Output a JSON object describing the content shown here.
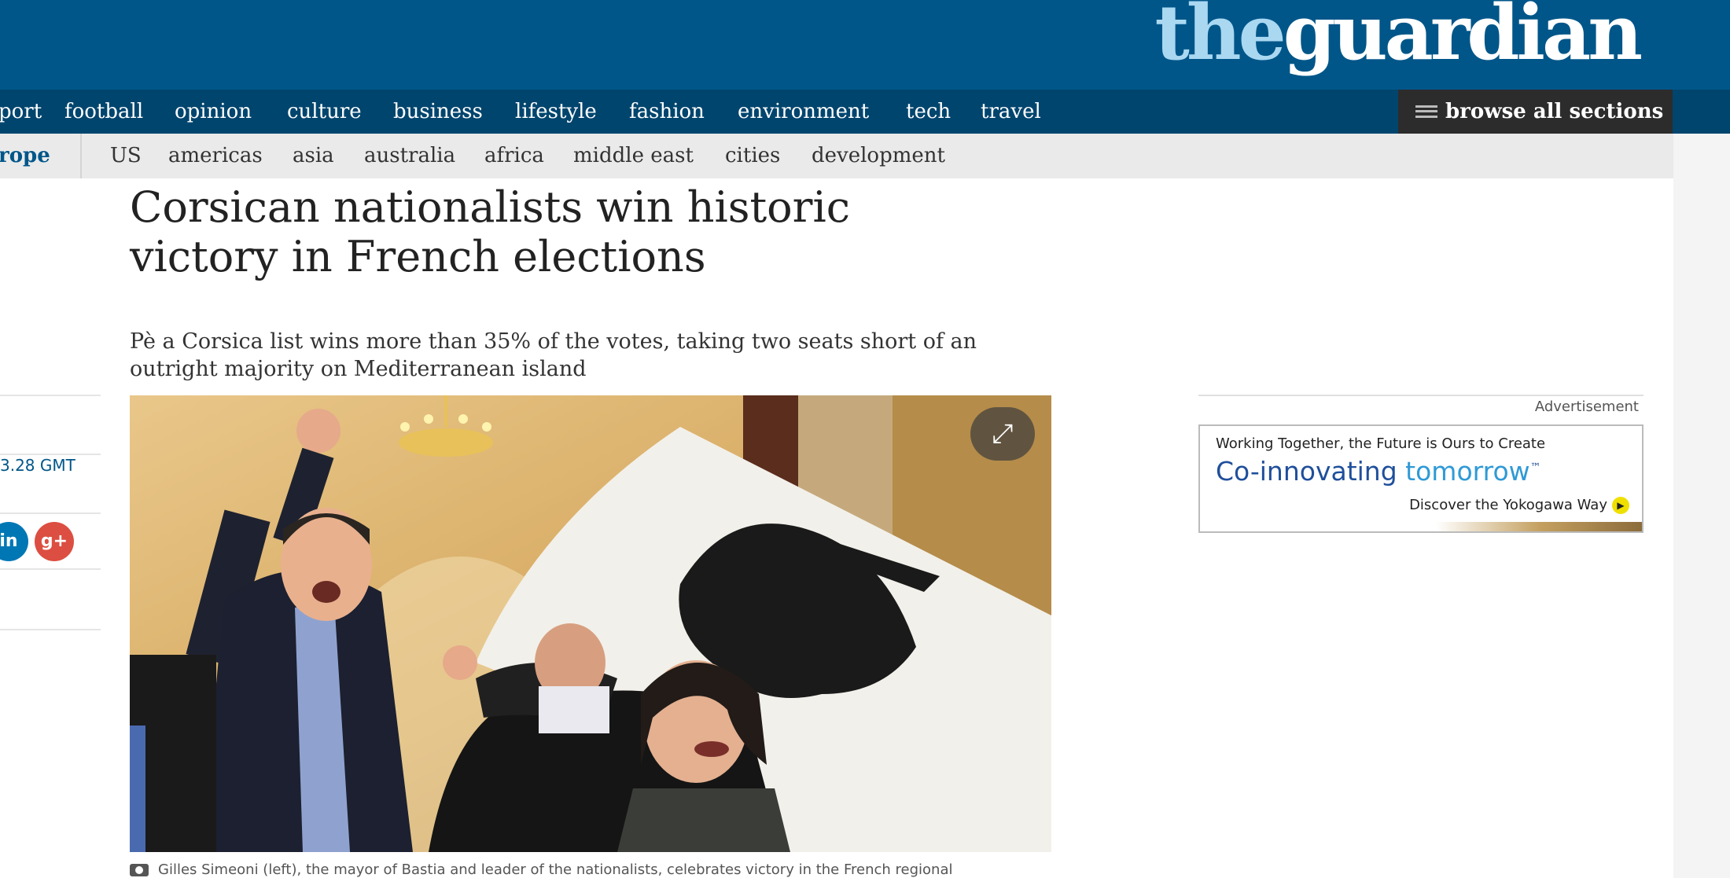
{
  "header": {
    "logo_the": "the",
    "logo_guardian": "guardian"
  },
  "nav": {
    "items": [
      "port",
      "football",
      "opinion",
      "culture",
      "business",
      "lifestyle",
      "fashion",
      "environment",
      "tech",
      "travel"
    ],
    "browse_label": "browse all sections"
  },
  "subnav": {
    "active": "rope",
    "items": [
      "US",
      "americas",
      "asia",
      "australia",
      "africa",
      "middle east",
      "cities",
      "development"
    ]
  },
  "article": {
    "headline_line1": "Corsican nationalists win historic",
    "headline_line2": "victory in French elections",
    "standfirst_line1": "Pè a Corsica list wins more than 35% of the votes, taking two seats short of an",
    "standfirst_line2": "outright majority on Mediterranean island",
    "timestamp": "3.28 GMT",
    "caption": "Gilles Simeoni (left), the mayor of Bastia and leader of the nationalists, celebrates victory in the French regional"
  },
  "share": {
    "linkedin": "in",
    "gplus": "g+"
  },
  "ad": {
    "label": "Advertisement",
    "line1": "Working Together, the Future is Ours to Create",
    "line2a": "Co-innovating",
    "line2b": "tomorrow",
    "tm": "™",
    "line3": "Discover the Yokogawa Way",
    "arrow": "▶"
  },
  "icons": {
    "expand": "⤢"
  },
  "colors": {
    "brand_blue": "#005689",
    "nav_blue": "#00456e",
    "logo_light": "#aad8f1",
    "browse_bg": "#2c2c2c",
    "gplus_red": "#dc4e41",
    "linkedin_blue": "#0077b5"
  }
}
